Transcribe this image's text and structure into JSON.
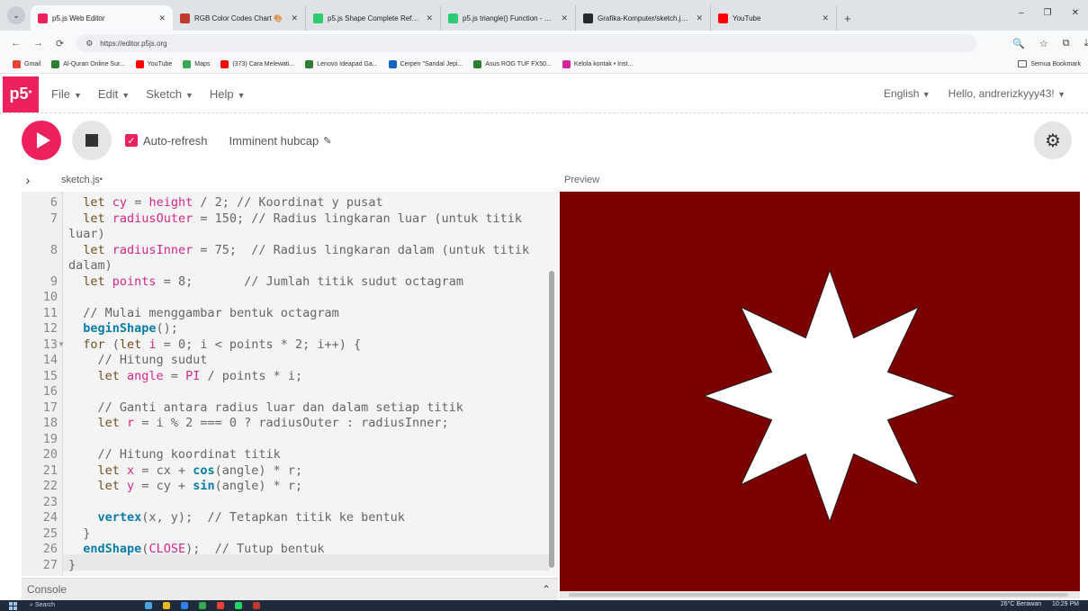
{
  "browser": {
    "tabs": [
      {
        "label": "p5.js Web Editor",
        "color": "#ed225d",
        "active": true
      },
      {
        "label": "RGB Color Codes Chart 🎨",
        "color": "#c0392b",
        "active": false
      },
      {
        "label": "p5.js Shape Complete Referenc",
        "color": "#2ecc71",
        "active": false
      },
      {
        "label": "p5.js triangle() Function - Geek",
        "color": "#2ecc71",
        "active": false
      },
      {
        "label": "Grafika-Komputer/sketch.js at",
        "color": "#24292e",
        "active": false
      },
      {
        "label": "YouTube",
        "color": "#ff0000",
        "active": false
      }
    ],
    "url": "https://editor.p5js.org",
    "bookmarks": [
      {
        "label": "Gmail",
        "color": "#ea4335"
      },
      {
        "label": "Al-Quran Online Sur...",
        "color": "#2e7d32"
      },
      {
        "label": "YouTube",
        "color": "#ff0000"
      },
      {
        "label": "Maps",
        "color": "#34a853"
      },
      {
        "label": "(373) Cara Melewati...",
        "color": "#ff0000"
      },
      {
        "label": "Lenovo Ideapad Ga...",
        "color": "#2e7d32"
      },
      {
        "label": "Cerpen \"Sandal Jepi...",
        "color": "#1565c0"
      },
      {
        "label": "Asus ROG TUF FX50...",
        "color": "#2e7d32"
      },
      {
        "label": "Kelola kontak • Inst...",
        "color": "#d6249f"
      }
    ],
    "all_bookmarks": "Semua Bookmark"
  },
  "p5": {
    "menus": [
      "File",
      "Edit",
      "Sketch",
      "Help"
    ],
    "language": "English",
    "user": "Hello, andrerizkyyy43!",
    "auto_refresh": "Auto-refresh",
    "sketch_name": "Imminent hubcap",
    "filename": "sketch.js",
    "unsaved_dot": "•",
    "preview_label": "Preview",
    "console_label": "Console",
    "accent": "#ed225d",
    "preview_bg": "#7b0000"
  },
  "code_lines": [
    {
      "n": "6",
      "text": "  let cy = height / 2; // Koordinat y pusat"
    },
    {
      "n": "7",
      "text": "  let radiusOuter = 150; // Radius lingkaran luar (untuk titik luar)"
    },
    {
      "n": "8",
      "text": "  let radiusInner = 75;  // Radius lingkaran dalam (untuk titik dalam)"
    },
    {
      "n": "9",
      "text": "  let points = 8;       // Jumlah titik sudut octagram"
    },
    {
      "n": "10",
      "text": ""
    },
    {
      "n": "11",
      "text": "  // Mulai menggambar bentuk octagram"
    },
    {
      "n": "12",
      "text": "  beginShape();"
    },
    {
      "n": "13",
      "text": "  for (let i = 0; i < points * 2; i++) {"
    },
    {
      "n": "14",
      "text": "    // Hitung sudut"
    },
    {
      "n": "15",
      "text": "    let angle = PI / points * i;"
    },
    {
      "n": "16",
      "text": ""
    },
    {
      "n": "17",
      "text": "    // Ganti antara radius luar dan dalam setiap titik"
    },
    {
      "n": "18",
      "text": "    let r = i % 2 === 0 ? radiusOuter : radiusInner;"
    },
    {
      "n": "19",
      "text": ""
    },
    {
      "n": "20",
      "text": "    // Hitung koordinat titik"
    },
    {
      "n": "21",
      "text": "    let x = cx + cos(angle) * r;"
    },
    {
      "n": "22",
      "text": "    let y = cy + sin(angle) * r;"
    },
    {
      "n": "23",
      "text": ""
    },
    {
      "n": "24",
      "text": "    vertex(x, y);  // Tetapkan titik ke bentuk"
    },
    {
      "n": "25",
      "text": "  }"
    },
    {
      "n": "26",
      "text": "  endShape(CLOSE);  // Tutup bentuk"
    },
    {
      "n": "27",
      "text": "}"
    }
  ],
  "taskbar": {
    "search": "Search",
    "weather": "26°C Berawan",
    "time": "10:29 PM"
  }
}
